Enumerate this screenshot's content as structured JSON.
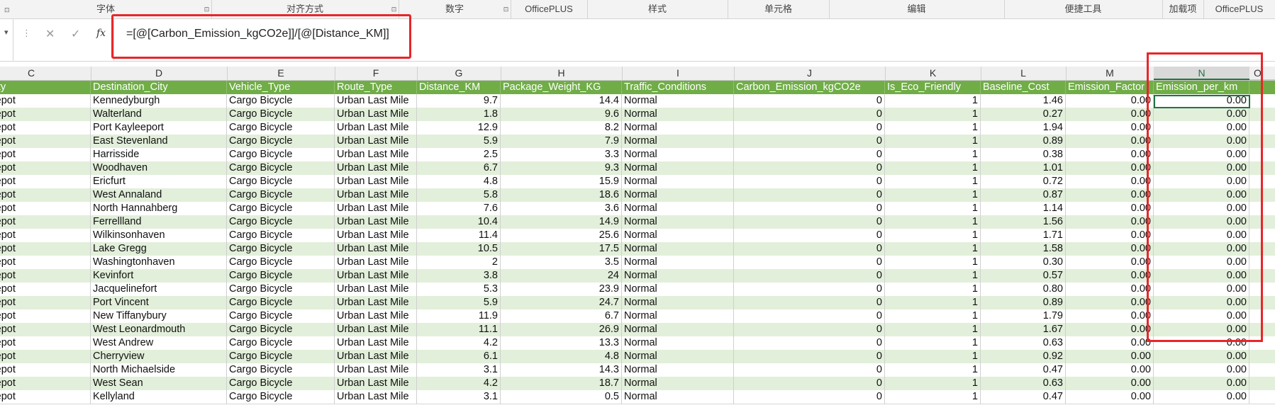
{
  "ribbon": {
    "groups": [
      {
        "label": "字体",
        "launcher": "⊡"
      },
      {
        "label": "对齐方式",
        "launcher": "⊡"
      },
      {
        "label": "数字",
        "launcher": "⊡"
      },
      {
        "label": "OfficePLUS"
      },
      {
        "label": "样式"
      },
      {
        "label": "单元格"
      },
      {
        "label": "编辑"
      },
      {
        "label": "便捷工具"
      },
      {
        "label": "加载项"
      },
      {
        "label": "OfficePLUS"
      }
    ]
  },
  "formula_bar": {
    "namebox_arrow": "▾",
    "dots": "⋮",
    "cancel_icon": "✕",
    "enter_icon": "✓",
    "fx_label": "fx",
    "formula": "=[@[Carbon_Emission_kgCO2e]]/[@[Distance_KM]]",
    "highlight_color": "#e8262a"
  },
  "grid": {
    "column_letters": [
      "C",
      "D",
      "E",
      "F",
      "G",
      "H",
      "I",
      "J",
      "K",
      "L",
      "M",
      "N"
    ],
    "extra_column_letter": "O",
    "selected_column": "N",
    "header_row": [
      "Facility",
      "Destination_City",
      "Vehicle_Type",
      "Route_Type",
      "Distance_KM",
      "Package_Weight_KG",
      "Traffic_Conditions",
      "Carbon_Emission_kgCO2e",
      "Is_Eco_Friendly",
      "Baseline_Cost",
      "Emission_Factor",
      "Emission_per_km"
    ],
    "header_color": "#70ad47",
    "band_color": "#e2efda",
    "rows": [
      [
        "ng Depot",
        "Kennedyburgh",
        "Cargo Bicycle",
        "Urban Last Mile",
        "9.7",
        "14.4",
        "Normal",
        "0",
        "1",
        "1.46",
        "0.00",
        "0.00"
      ],
      [
        "ng Depot",
        "Walterland",
        "Cargo Bicycle",
        "Urban Last Mile",
        "1.8",
        "9.6",
        "Normal",
        "0",
        "1",
        "0.27",
        "0.00",
        "0.00"
      ],
      [
        "ng Depot",
        "Port Kayleeport",
        "Cargo Bicycle",
        "Urban Last Mile",
        "12.9",
        "8.2",
        "Normal",
        "0",
        "1",
        "1.94",
        "0.00",
        "0.00"
      ],
      [
        "ng Depot",
        "East Stevenland",
        "Cargo Bicycle",
        "Urban Last Mile",
        "5.9",
        "7.9",
        "Normal",
        "0",
        "1",
        "0.89",
        "0.00",
        "0.00"
      ],
      [
        "ng Depot",
        "Harrisside",
        "Cargo Bicycle",
        "Urban Last Mile",
        "2.5",
        "3.3",
        "Normal",
        "0",
        "1",
        "0.38",
        "0.00",
        "0.00"
      ],
      [
        "ng Depot",
        "Woodhaven",
        "Cargo Bicycle",
        "Urban Last Mile",
        "6.7",
        "9.3",
        "Normal",
        "0",
        "1",
        "1.01",
        "0.00",
        "0.00"
      ],
      [
        "ng Depot",
        "Ericfurt",
        "Cargo Bicycle",
        "Urban Last Mile",
        "4.8",
        "15.9",
        "Normal",
        "0",
        "1",
        "0.72",
        "0.00",
        "0.00"
      ],
      [
        "ng Depot",
        "West Annaland",
        "Cargo Bicycle",
        "Urban Last Mile",
        "5.8",
        "18.6",
        "Normal",
        "0",
        "1",
        "0.87",
        "0.00",
        "0.00"
      ],
      [
        "ng Depot",
        "North Hannahberg",
        "Cargo Bicycle",
        "Urban Last Mile",
        "7.6",
        "3.6",
        "Normal",
        "0",
        "1",
        "1.14",
        "0.00",
        "0.00"
      ],
      [
        "ng Depot",
        "Ferrellland",
        "Cargo Bicycle",
        "Urban Last Mile",
        "10.4",
        "14.9",
        "Normal",
        "0",
        "1",
        "1.56",
        "0.00",
        "0.00"
      ],
      [
        "ng Depot",
        "Wilkinsonhaven",
        "Cargo Bicycle",
        "Urban Last Mile",
        "11.4",
        "25.6",
        "Normal",
        "0",
        "1",
        "1.71",
        "0.00",
        "0.00"
      ],
      [
        "ng Depot",
        "Lake Gregg",
        "Cargo Bicycle",
        "Urban Last Mile",
        "10.5",
        "17.5",
        "Normal",
        "0",
        "1",
        "1.58",
        "0.00",
        "0.00"
      ],
      [
        "ng Depot",
        "Washingtonhaven",
        "Cargo Bicycle",
        "Urban Last Mile",
        "2",
        "3.5",
        "Normal",
        "0",
        "1",
        "0.30",
        "0.00",
        "0.00"
      ],
      [
        "ng Depot",
        "Kevinfort",
        "Cargo Bicycle",
        "Urban Last Mile",
        "3.8",
        "24",
        "Normal",
        "0",
        "1",
        "0.57",
        "0.00",
        "0.00"
      ],
      [
        "ng Depot",
        "Jacquelinefort",
        "Cargo Bicycle",
        "Urban Last Mile",
        "5.3",
        "23.9",
        "Normal",
        "0",
        "1",
        "0.80",
        "0.00",
        "0.00"
      ],
      [
        "ng Depot",
        "Port Vincent",
        "Cargo Bicycle",
        "Urban Last Mile",
        "5.9",
        "24.7",
        "Normal",
        "0",
        "1",
        "0.89",
        "0.00",
        "0.00"
      ],
      [
        "ng Depot",
        "New Tiffanybury",
        "Cargo Bicycle",
        "Urban Last Mile",
        "11.9",
        "6.7",
        "Normal",
        "0",
        "1",
        "1.79",
        "0.00",
        "0.00"
      ],
      [
        "ng Depot",
        "West Leonardmouth",
        "Cargo Bicycle",
        "Urban Last Mile",
        "11.1",
        "26.9",
        "Normal",
        "0",
        "1",
        "1.67",
        "0.00",
        "0.00"
      ],
      [
        "ng Depot",
        "West Andrew",
        "Cargo Bicycle",
        "Urban Last Mile",
        "4.2",
        "13.3",
        "Normal",
        "0",
        "1",
        "0.63",
        "0.00",
        "0.00"
      ],
      [
        "ng Depot",
        "Cherryview",
        "Cargo Bicycle",
        "Urban Last Mile",
        "6.1",
        "4.8",
        "Normal",
        "0",
        "1",
        "0.92",
        "0.00",
        "0.00"
      ],
      [
        "ng Depot",
        "North Michaelside",
        "Cargo Bicycle",
        "Urban Last Mile",
        "3.1",
        "14.3",
        "Normal",
        "0",
        "1",
        "0.47",
        "0.00",
        "0.00"
      ],
      [
        "ng Depot",
        "West Sean",
        "Cargo Bicycle",
        "Urban Last Mile",
        "4.2",
        "18.7",
        "Normal",
        "0",
        "1",
        "0.63",
        "0.00",
        "0.00"
      ],
      [
        "ng Depot",
        "Kellyland",
        "Cargo Bicycle",
        "Urban Last Mile",
        "3.1",
        "0.5",
        "Normal",
        "0",
        "1",
        "0.47",
        "0.00",
        "0.00"
      ]
    ]
  }
}
